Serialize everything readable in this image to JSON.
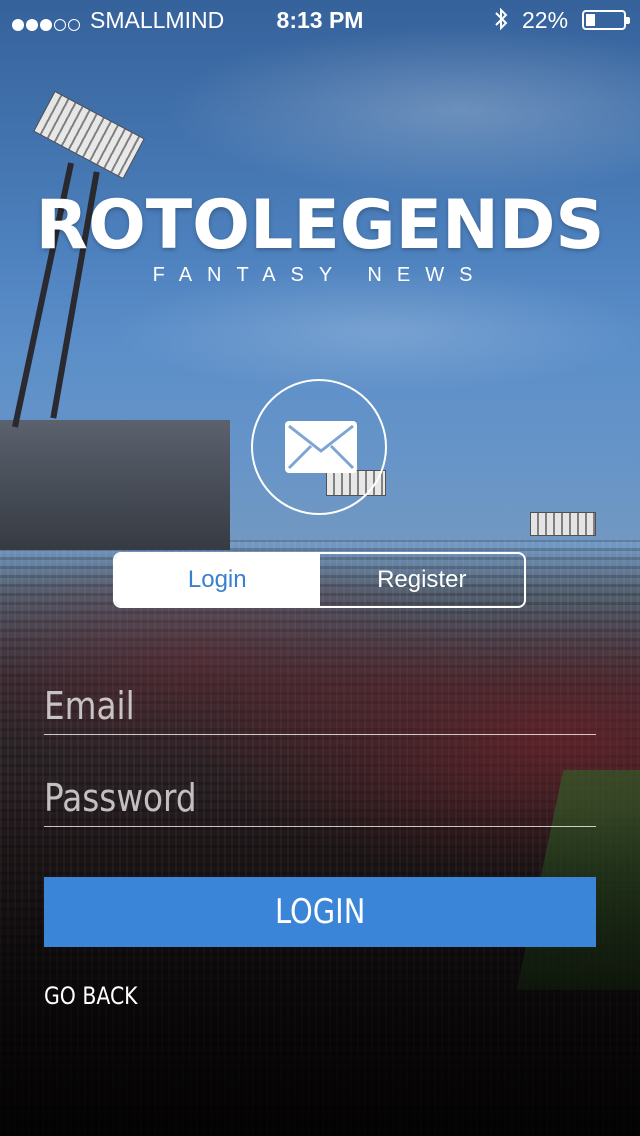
{
  "status_bar": {
    "carrier": "SMALLMIND",
    "time": "8:13 PM",
    "battery": "22%",
    "signal_bars_filled": 3,
    "signal_bars_total": 5
  },
  "logo": {
    "title": "ROTOLEGENDS",
    "subtitle": "FANTASY NEWS"
  },
  "tabs": [
    {
      "label": "Login",
      "active": true
    },
    {
      "label": "Register",
      "active": false
    }
  ],
  "form": {
    "email_placeholder": "Email",
    "password_placeholder": "Password",
    "login_label": "LOGIN",
    "go_back_label": "GO BACK"
  },
  "colors": {
    "accent": "#3a85d8",
    "tab_active_text": "#3a7fd0"
  },
  "icons": [
    "mail-icon",
    "bluetooth-icon",
    "battery-icon"
  ]
}
